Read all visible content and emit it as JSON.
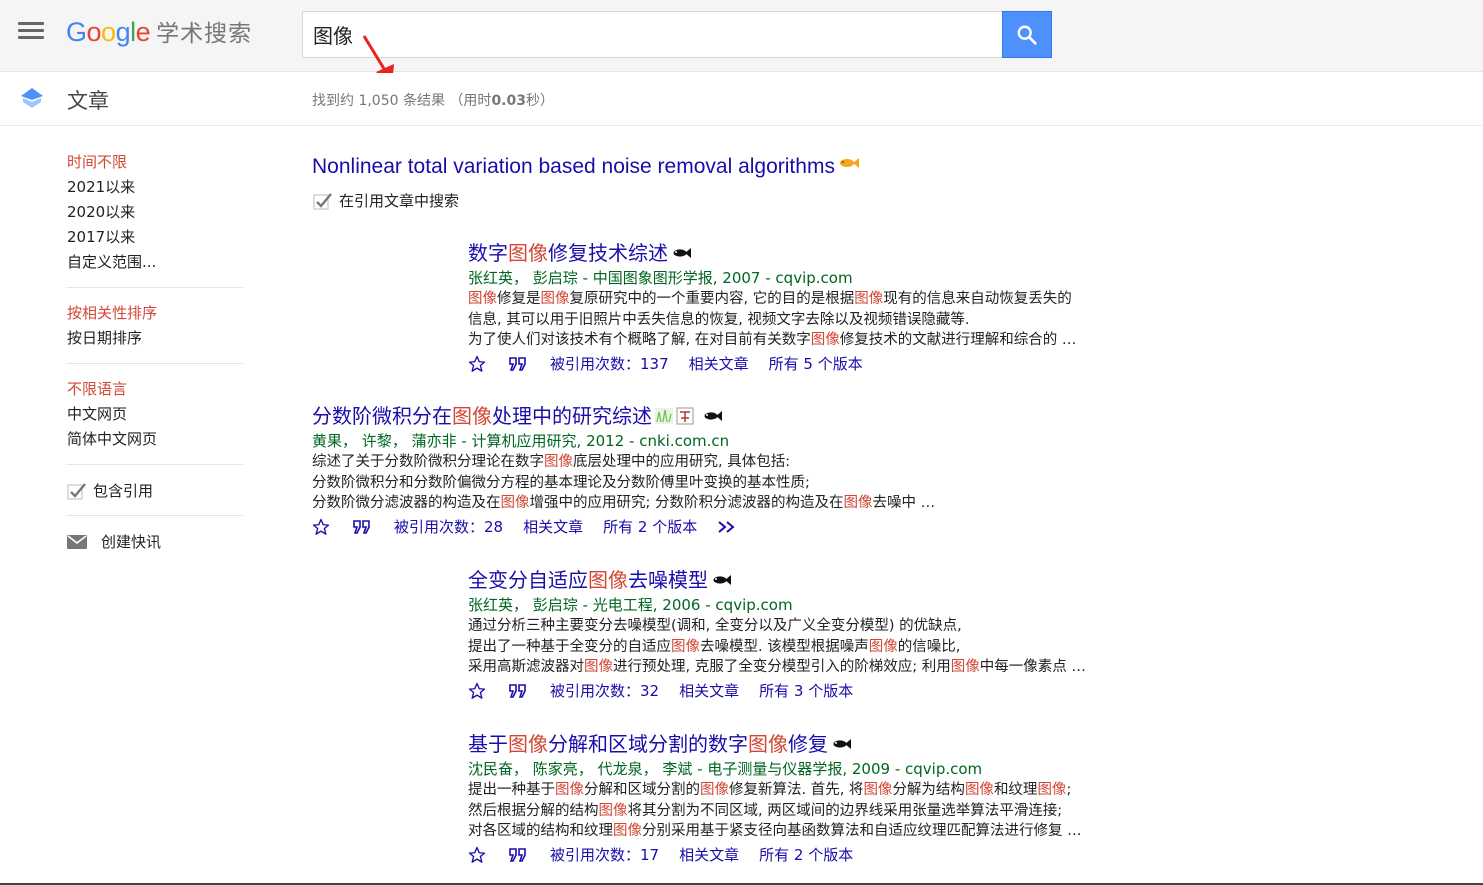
{
  "header": {
    "logo_google": "Google",
    "logo_suffix": "学术搜索",
    "search_value": "图像",
    "brand_colors": {
      "blue": "#4285f4",
      "red": "#ea4335",
      "yellow": "#fbbc05",
      "green": "#34a853"
    }
  },
  "subheader": {
    "section_title": "文章",
    "result_stats_prefix": "找到约 1,050 条结果  （用时",
    "result_stats_time": "0.03",
    "result_stats_suffix": "秒）"
  },
  "sidebar": {
    "time_filters": [
      "时间不限",
      "2021以来",
      "2020以来",
      "2017以来",
      "自定义范围..."
    ],
    "sort_options": [
      "按相关性排序",
      "按日期排序"
    ],
    "language_options": [
      "不限语言",
      "中文网页",
      "简体中文网页"
    ],
    "include_citations_label": "包含引用",
    "create_alert_label": "创建快讯"
  },
  "citing": {
    "title": "Nonlinear total variation based noise removal algorithms",
    "search_within_label": "在引用文章中搜索"
  },
  "results": [
    {
      "title_parts": [
        "数字",
        "图像",
        "修复技术综述"
      ],
      "authors": [
        "张红英",
        "彭启琮"
      ],
      "source": " - 中国图象图形学报, 2007 - cqvip.com",
      "snippet_lines": [
        [
          "",
          "图像",
          "修复是",
          "图像",
          "复原研究中的一个重要内容, 它的目的是根据",
          "图像",
          "现有的信息来自动恢复丢失的"
        ],
        [
          "信息, 其可以用于旧照片中丢失信息的恢复, 视频文字去除以及视频错误隐藏等."
        ],
        [
          "为了使人们对该技术有个概略了解, 在对目前有关数字",
          "图像",
          "修复技术的文献进行理解和综合的 …"
        ]
      ],
      "cited_by": "被引用次数：137",
      "related": "相关文章",
      "versions": "所有 5 个版本"
    },
    {
      "title_parts": [
        "分数阶微积分在",
        "图像",
        "处理中的研究综述"
      ],
      "authors": [
        "黄果",
        "许黎",
        "蒲亦非"
      ],
      "source": " - 计算机应用研究, 2012 - cnki.com.cn",
      "snippet_lines": [
        [
          "综述了关于分数阶微积分理论在数字",
          "图像",
          "底层处理中的应用研究, 具体包括:"
        ],
        [
          "分数阶微积分和分数阶偏微分方程的基本理论及分数阶傅里叶变换的基本性质;"
        ],
        [
          "分数阶微分滤波器的构造及在",
          "图像",
          "增强中的应用研究; 分数阶积分滤波器的构造及在",
          "图像",
          "去噪中 …"
        ]
      ],
      "cited_by": "被引用次数：28",
      "related": "相关文章",
      "versions": "所有 2 个版本"
    },
    {
      "title_parts": [
        "全变分自适应",
        "图像",
        "去噪模型"
      ],
      "authors": [
        "张红英",
        "彭启琮"
      ],
      "source": " - 光电工程, 2006 - cqvip.com",
      "snippet_lines": [
        [
          "通过分析三种主要变分去噪模型(调和, 全变分以及广义全变分模型) 的优缺点,"
        ],
        [
          "提出了一种基于全变分的自适应",
          "图像",
          "去噪模型. 该模型根据噪声",
          "图像",
          "的信噪比,"
        ],
        [
          "采用高斯滤波器对",
          "图像",
          "进行预处理, 克服了全变分模型引入的阶梯效应; 利用",
          "图像",
          "中每一像素点 …"
        ]
      ],
      "cited_by": "被引用次数：32",
      "related": "相关文章",
      "versions": "所有 3 个版本"
    },
    {
      "title_parts": [
        "基于",
        "图像",
        "分解和区域分割的数字",
        "图像",
        "修复"
      ],
      "authors": [
        "沈民奋",
        "陈家亮",
        "代龙泉",
        "李斌"
      ],
      "source": " - 电子测量与仪器学报, 2009 - cqvip.com",
      "snippet_lines": [
        [
          "提出一种基于",
          "图像",
          "分解和区域分割的",
          "图像",
          "修复新算法. 首先, 将",
          "图像",
          "分解为结构",
          "图像",
          "和纹理",
          "图像",
          ";"
        ],
        [
          "然后根据分解的结构",
          "图像",
          "将其分割为不同区域, 两区域间的边界线采用张量选举算法平滑连接;"
        ],
        [
          "对各区域的结构和纹理",
          "图像",
          "分别采用基于紧支径向基函数算法和自适应纹理匹配算法进行修复 …"
        ]
      ],
      "cited_by": "被引用次数：17",
      "related": "相关文章",
      "versions": "所有 2 个版本"
    }
  ]
}
